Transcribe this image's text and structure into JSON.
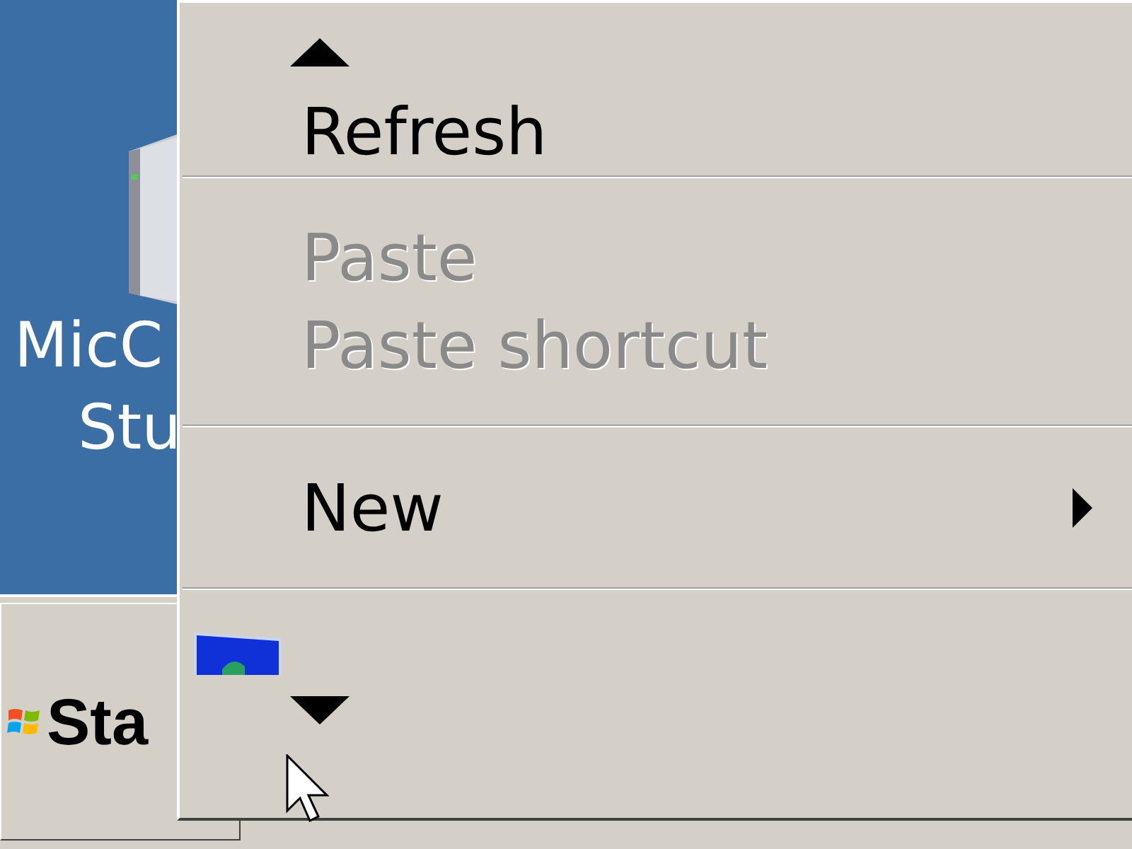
{
  "desktop": {
    "icon": {
      "label_lines": [
        "MicC",
        "Stu"
      ]
    }
  },
  "taskbar": {
    "start_button": {
      "label": "Sta"
    }
  },
  "context_menu": {
    "items": [
      {
        "kind": "command",
        "label": "Refresh",
        "disabled": false
      },
      {
        "kind": "separator"
      },
      {
        "kind": "command",
        "label": "Paste",
        "disabled": true
      },
      {
        "kind": "command",
        "label": "Paste shortcut",
        "disabled": true
      },
      {
        "kind": "separator"
      },
      {
        "kind": "submenu",
        "label": "New",
        "disabled": false
      },
      {
        "kind": "separator"
      },
      {
        "kind": "icon_only"
      }
    ]
  }
}
